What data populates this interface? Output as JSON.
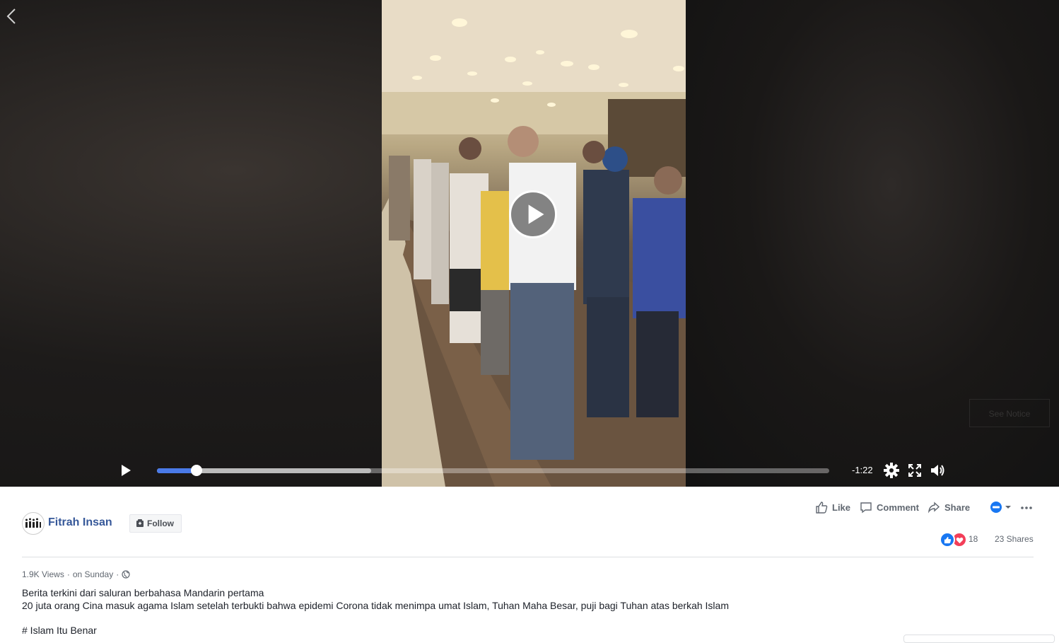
{
  "video": {
    "time_remaining": "-1:22",
    "progress_fraction": 0.059,
    "buffered_fraction": 0.319,
    "see_notice_label": "See Notice"
  },
  "post": {
    "page_name": "Fitrah Insan",
    "follow_label": "Follow",
    "actions": {
      "like": "Like",
      "comment": "Comment",
      "share": "Share"
    },
    "reaction_count": "18",
    "shares": "23 Shares",
    "meta": {
      "views": "1.9K Views",
      "separator": "·",
      "date": "on Sunday",
      "separator2": "·"
    },
    "caption_lines": [
      "Berita terkini dari saluran berbahasa Mandarin pertama",
      "20 juta orang Cina masuk agama Islam setelah terbukti bahwa epidemi Corona tidak menimpa umat Islam, Tuhan Maha Besar, puji bagi Tuhan atas berkah Islam"
    ],
    "hashtag": "# Islam Itu Benar"
  },
  "colors": {
    "link": "#365899",
    "progress": "#4a7ae8",
    "like_blue": "#1877f2",
    "love_red": "#f33e58"
  },
  "icons": [
    "back-arrow-icon",
    "play-icon",
    "settings-icon",
    "fullscreen-icon",
    "volume-icon",
    "like-icon",
    "comment-icon",
    "share-icon",
    "globe-icon",
    "more-icon"
  ]
}
